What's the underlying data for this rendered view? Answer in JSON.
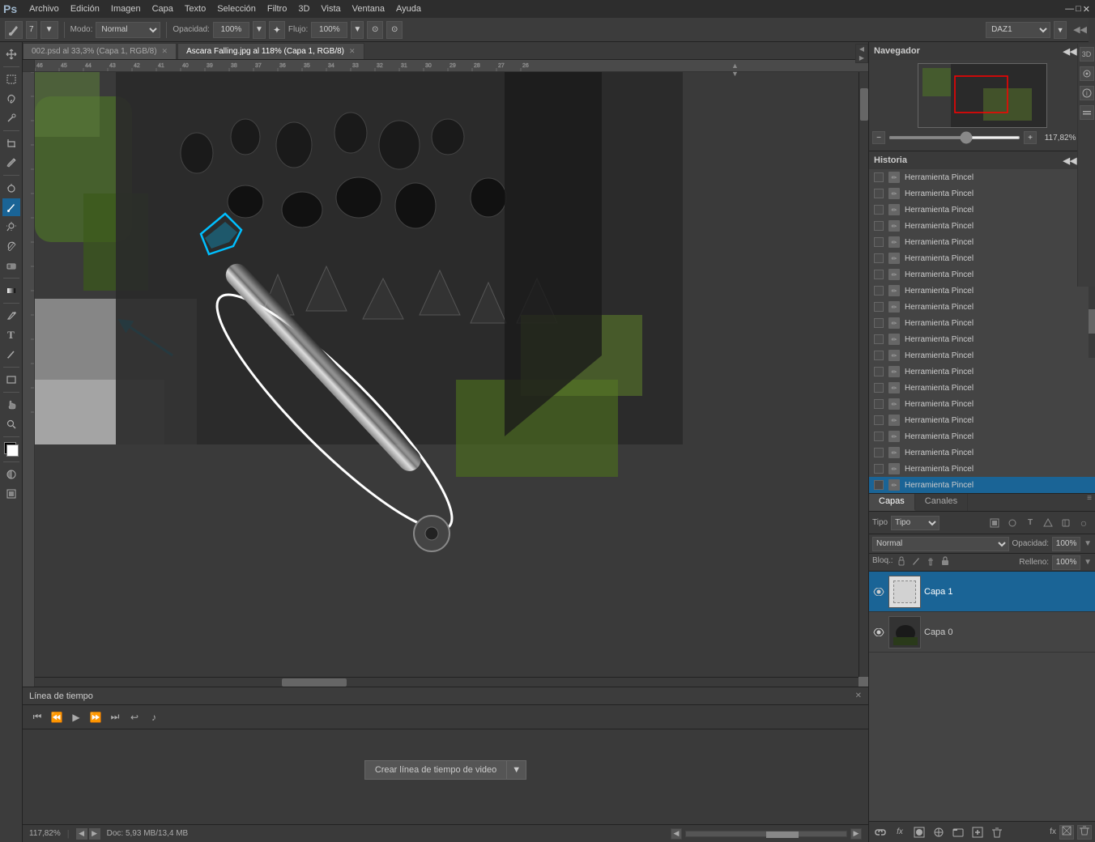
{
  "app": {
    "title": "Adobe Photoshop",
    "logo": "Ps"
  },
  "menubar": {
    "items": [
      "Archivo",
      "Edición",
      "Imagen",
      "Capa",
      "Texto",
      "Selección",
      "Filtro",
      "3D",
      "Vista",
      "Ventana",
      "Ayuda"
    ]
  },
  "toolbar": {
    "brush_size_label": "7",
    "mode_label": "Modo:",
    "mode_value": "Normal",
    "opacity_label": "Opacidad:",
    "opacity_value": "100%",
    "flow_label": "Flujo:",
    "flow_value": "100%",
    "workspace_dropdown": "DAZ1"
  },
  "tabs": [
    {
      "label": "002.psd al 33,3% (Capa 1, RGB/8)",
      "active": false,
      "closable": true
    },
    {
      "label": "Ascara Falling.jpg al 118% (Capa 1, RGB/8)",
      "active": true,
      "closable": true
    }
  ],
  "navigator": {
    "title": "Navegador",
    "zoom_value": "117,82%"
  },
  "history": {
    "title": "Historia",
    "items": [
      "Herramienta Pincel",
      "Herramienta Pincel",
      "Herramienta Pincel",
      "Herramienta Pincel",
      "Herramienta Pincel",
      "Herramienta Pincel",
      "Herramienta Pincel",
      "Herramienta Pincel",
      "Herramienta Pincel",
      "Herramienta Pincel",
      "Herramienta Pincel",
      "Herramienta Pincel",
      "Herramienta Pincel",
      "Herramienta Pincel",
      "Herramienta Pincel",
      "Herramienta Pincel",
      "Herramienta Pincel",
      "Herramienta Pincel",
      "Herramienta Pincel",
      "Herramienta Pincel"
    ],
    "selected_index": 19
  },
  "layers": {
    "tabs": [
      "Capas",
      "Canales"
    ],
    "active_tab": "Capas",
    "search_placeholder": "Tipo",
    "mode_value": "Normal",
    "opacity_label": "Opacidad:",
    "opacity_value": "100%",
    "fill_label": "Relleno:",
    "fill_value": "100%",
    "lock_label": "Bloq.:",
    "items": [
      {
        "name": "Capa 1",
        "selected": true,
        "visible": true
      },
      {
        "name": "Capa 0",
        "selected": false,
        "visible": true
      }
    ],
    "footer_buttons": [
      "link-icon",
      "fx-icon",
      "mask-icon",
      "adjustment-icon",
      "group-icon",
      "new-layer-icon",
      "delete-icon"
    ]
  },
  "timeline": {
    "title": "Línea de tiempo",
    "create_button": "Crear línea de tiempo de video"
  },
  "statusbar": {
    "zoom": "117,82%",
    "doc_size": "Doc: 5,93 MB/13,4 MB"
  },
  "canvas": {
    "zoom": "117,82%"
  },
  "right_panel_icons": [
    "3d-icon",
    "settings-icon",
    "info-icon"
  ],
  "colors": {
    "accent_blue": "#1a6496",
    "bg_dark": "#3c3c3c",
    "bg_darker": "#2d2d2d",
    "panel_bg": "#444444",
    "selected_layer": "#1a6496"
  }
}
